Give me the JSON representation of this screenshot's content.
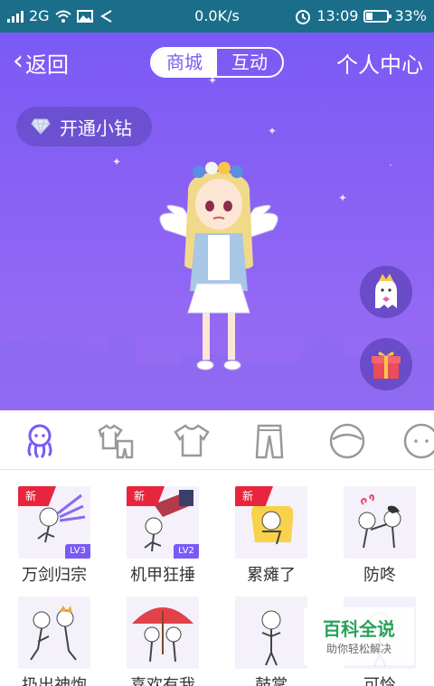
{
  "status_bar": {
    "network": "2G",
    "speed": "0.0K/s",
    "time": "13:09",
    "battery_percent_label": "33%",
    "battery_level": 0.33
  },
  "header": {
    "back_label": "返回",
    "tabs": [
      {
        "label": "商城",
        "active": true
      },
      {
        "label": "互动",
        "active": false
      }
    ],
    "center_link": "个人中心"
  },
  "vip_button": {
    "label": "开通小钻",
    "icon": "diamond-icon"
  },
  "floating_buttons": [
    {
      "icon": "crown-ghost-icon"
    },
    {
      "icon": "gift-box-icon"
    }
  ],
  "category_tabs": [
    {
      "icon": "octopus-icon",
      "active": true
    },
    {
      "icon": "tshirt-set-icon",
      "active": false
    },
    {
      "icon": "tshirt-icon",
      "active": false
    },
    {
      "icon": "pants-icon",
      "active": false
    },
    {
      "icon": "face-icon",
      "active": false
    },
    {
      "icon": "head-icon",
      "active": false
    }
  ],
  "items": [
    {
      "label": "万剑归宗",
      "new": true,
      "new_label": "新",
      "level": "LV3"
    },
    {
      "label": "机甲狂捶",
      "new": true,
      "new_label": "新",
      "level": "LV2"
    },
    {
      "label": "累瘫了",
      "new": true,
      "new_label": "新",
      "level": ""
    },
    {
      "label": "防咚",
      "new": false,
      "new_label": "",
      "level": ""
    },
    {
      "label": "扔出神炮",
      "new": false,
      "new_label": "",
      "level": ""
    },
    {
      "label": "喜欢有我",
      "new": false,
      "new_label": "",
      "level": ""
    },
    {
      "label": "鼓掌",
      "new": false,
      "new_label": "",
      "level": ""
    },
    {
      "label": "可怜",
      "new": false,
      "new_label": "",
      "level": ""
    }
  ],
  "watermark": {
    "title": "百科全说",
    "subtitle": "助你轻松解决"
  },
  "colors": {
    "status_bar": "#1a6e8a",
    "hero_purple": "#7a5af5",
    "accent": "#7a5af5",
    "new_tag": "#e8253c",
    "watermark_green": "#27a35a"
  }
}
